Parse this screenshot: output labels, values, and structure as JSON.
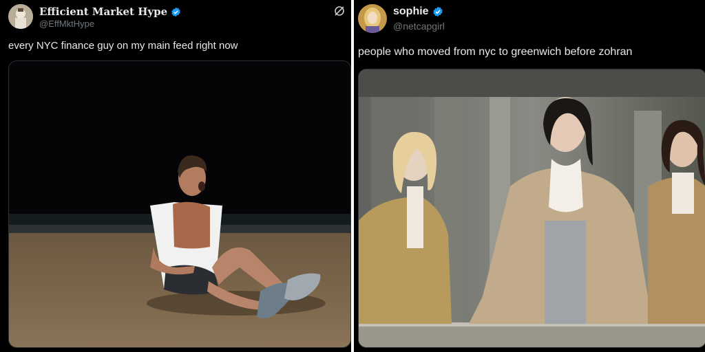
{
  "left_tweet": {
    "display_name": "Efficient Market Hype",
    "handle": "@EffMktHype",
    "text": "every NYC finance guy on my main feed right now",
    "avatar_icon": "avatar-icon",
    "verified_icon": "verified-badge-icon",
    "header_icon": "slashed-circle-icon",
    "media": "photo of a shirtless man sitting on a sandy beach at night, laughing"
  },
  "right_tweet": {
    "display_name": "sophie",
    "handle": "@netcapgirl",
    "text": "people who moved from nyc to greenwich before zohran",
    "avatar_icon": "avatar-icon",
    "verified_icon": "verified-badge-icon",
    "media": "still of three men in ornate 18th-century aristocratic costume standing at a stone balcony"
  },
  "colors": {
    "background": "#000000",
    "primary_text": "#e7e9ea",
    "secondary_text": "#71767b",
    "verified": "#1d9bf0",
    "divider": "#ffffff"
  }
}
